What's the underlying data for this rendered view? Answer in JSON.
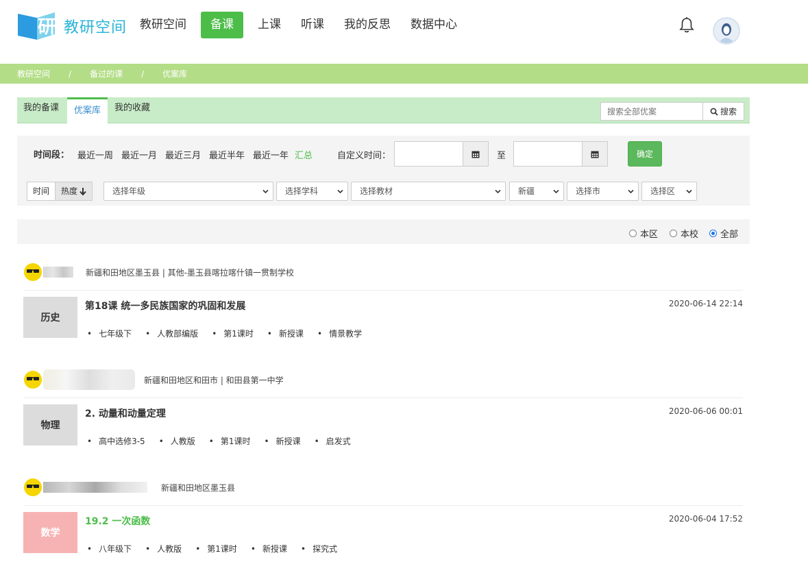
{
  "app": {
    "brand": "教研空间"
  },
  "nav": [
    "教研空间",
    "备课",
    "上课",
    "听课",
    "我的反思",
    "数据中心"
  ],
  "breadcrumb": [
    "教研空间",
    "备过的课",
    "优案库"
  ],
  "tabs": [
    "我的备课",
    "优案库",
    "我的收藏"
  ],
  "search": {
    "placeholder": "搜索全部优案",
    "button": "搜索"
  },
  "filters": {
    "time_label": "时间段：",
    "ranges": [
      "最近一周",
      "最近一月",
      "最近三月",
      "最近半年",
      "最近一年",
      "汇总"
    ],
    "custom_label": "自定义时间：",
    "to_label": "至",
    "confirm": "确定",
    "sort": [
      "时间",
      "热度"
    ],
    "selects": [
      "选择年级",
      "选择学科",
      "选择教材",
      "新疆",
      "选择市",
      "选择区"
    ]
  },
  "scope": {
    "options": [
      "本区",
      "本校",
      "全部"
    ],
    "selected": "全部"
  },
  "entries": [
    {
      "location": "新疆和田地区墨玉县 | 其他-墨玉县喀拉喀什镇一贯制学校",
      "subject": "历史",
      "title": "第18课 统一多民族国家的巩固和发展",
      "date": "2020-06-14 22:14",
      "tags": [
        "七年级下",
        "人教部编版",
        "第1课时",
        "新授课",
        "情景教学"
      ]
    },
    {
      "location": "新疆和田地区和田市 | 和田县第一中学",
      "subject": "物理",
      "title": "2. 动量和动量定理",
      "date": "2020-06-06 00:01",
      "tags": [
        "高中选修3-5",
        "人教版",
        "第1课时",
        "新授课",
        "启发式"
      ]
    },
    {
      "location": "新疆和田地区墨玉县",
      "subject": "数学",
      "title": "19.2 一次函数",
      "date": "2020-06-04 17:52",
      "tags": [
        "八年级下",
        "人教版",
        "第1课时",
        "新授课",
        "探究式"
      ]
    }
  ],
  "colors": {
    "accent": "#4dbd4a",
    "breadcrumb_bg": "#b3dd86",
    "brand": "#28b4d6"
  }
}
